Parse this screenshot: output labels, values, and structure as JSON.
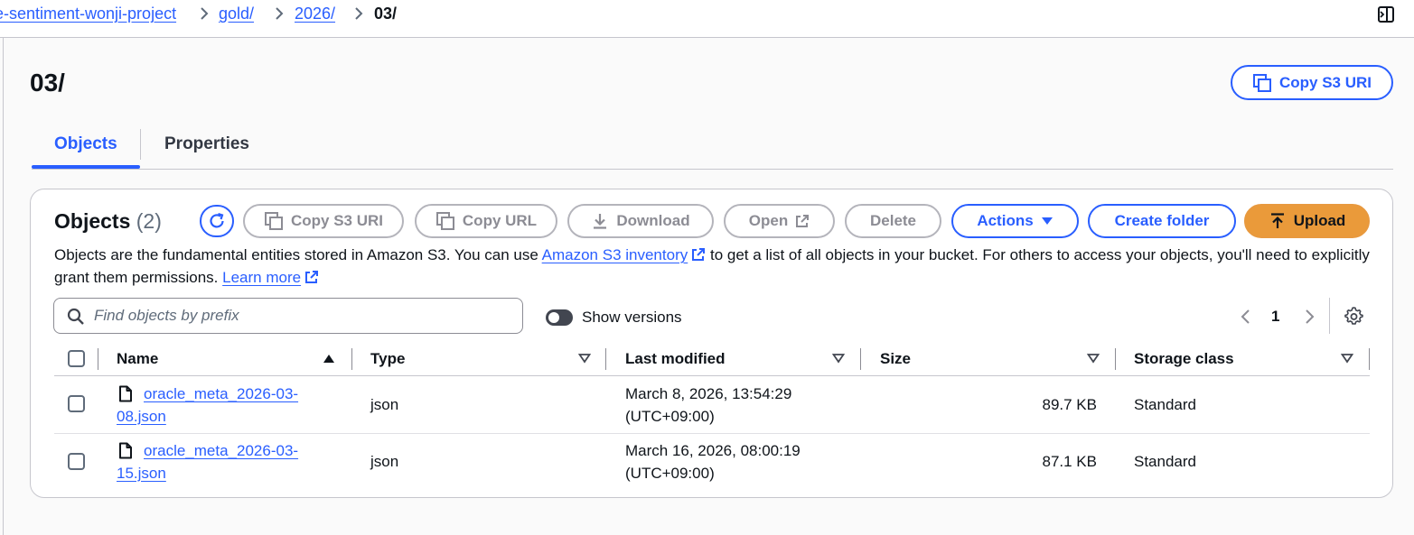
{
  "breadcrumb": {
    "bucket": "e-sentiment-wonji-project",
    "level1": "gold/",
    "level2": "2026/",
    "current": "03/"
  },
  "page": {
    "title": "03/",
    "copy_s3_uri": "Copy S3 URI"
  },
  "tabs": [
    {
      "label": "Objects",
      "active": true
    },
    {
      "label": "Properties",
      "active": false
    }
  ],
  "objects_panel": {
    "title": "Objects",
    "count": "(2)",
    "buttons": {
      "copy_s3_uri": "Copy S3 URI",
      "copy_url": "Copy URL",
      "download": "Download",
      "open": "Open",
      "delete": "Delete",
      "actions": "Actions",
      "create_folder": "Create folder",
      "upload": "Upload"
    },
    "description_part1": "Objects are the fundamental entities stored in Amazon S3. You can use",
    "inventory_link": "Amazon S3 inventory",
    "description_part2": "to get a list of all objects in your bucket. For others to access your objects, you'll need to explicitly grant them permissions.",
    "learn_more": "Learn more",
    "search_placeholder": "Find objects by prefix",
    "show_versions": "Show versions",
    "show_versions_on": false,
    "page_number": "1"
  },
  "table": {
    "columns": [
      "Name",
      "Type",
      "Last modified",
      "Size",
      "Storage class"
    ],
    "rows": [
      {
        "name_line1": "oracle_meta_2026-03-",
        "name_line2": "08.json",
        "type": "json",
        "modified_line1": "March 8, 2026, 13:54:29",
        "modified_line2": "(UTC+09:00)",
        "size": "89.7 KB",
        "storage_class": "Standard"
      },
      {
        "name_line1": "oracle_meta_2026-03-",
        "name_line2": "15.json",
        "type": "json",
        "modified_line1": "March 16, 2026, 08:00:19",
        "modified_line2": "(UTC+09:00)",
        "size": "87.1 KB",
        "storage_class": "Standard"
      }
    ]
  },
  "colors": {
    "accent": "#295eff",
    "upload": "#ea9a3a",
    "disabled": "#8c8c94",
    "text": "#0f141a"
  },
  "icons": [
    "chevron-right-icon",
    "side-panel-icon",
    "copy-icon",
    "refresh-icon",
    "download-icon",
    "external-link-icon",
    "caret-down-icon",
    "upload-icon",
    "search-icon",
    "chevron-left-icon",
    "gear-icon",
    "sort-asc-icon",
    "sort-desc-icon",
    "file-icon"
  ]
}
